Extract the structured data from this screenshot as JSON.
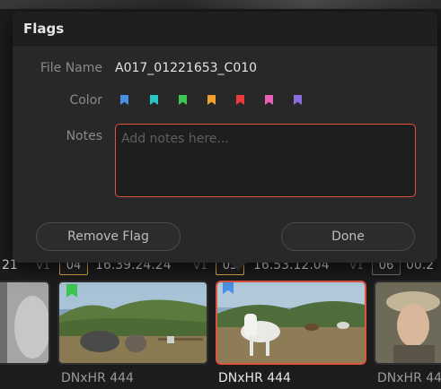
{
  "dialog": {
    "title": "Flags",
    "file_name_label": "File Name",
    "file_name_value": "A017_01221653_C010",
    "color_label": "Color",
    "notes_label": "Notes",
    "notes_placeholder": "Add notes here...",
    "remove_flag_label": "Remove Flag",
    "done_label": "Done",
    "flag_colors": [
      {
        "name": "blue",
        "hex": "#4a90e2"
      },
      {
        "name": "cyan",
        "hex": "#28c7c7"
      },
      {
        "name": "green",
        "hex": "#3ec455"
      },
      {
        "name": "yellow",
        "hex": "#f0a030"
      },
      {
        "name": "red",
        "hex": "#e83c3c"
      },
      {
        "name": "pink",
        "hex": "#e860b8"
      },
      {
        "name": "purple",
        "hex": "#8a6ee0"
      }
    ]
  },
  "timeline": {
    "clips": [
      {
        "track": "V1",
        "index": "",
        "timecode": "21",
        "codec": "",
        "flag": ""
      },
      {
        "track": "V1",
        "index": "04",
        "timecode": "16.39.24.24",
        "codec": "DNxHR 444",
        "flag": "green"
      },
      {
        "track": "V1",
        "index": "05",
        "timecode": "16.53.12.04",
        "codec": "DNxHR 444",
        "flag": "blue"
      },
      {
        "track": "V1",
        "index": "06",
        "timecode": "00.2",
        "codec": "DNxHR 444",
        "flag": ""
      }
    ]
  }
}
